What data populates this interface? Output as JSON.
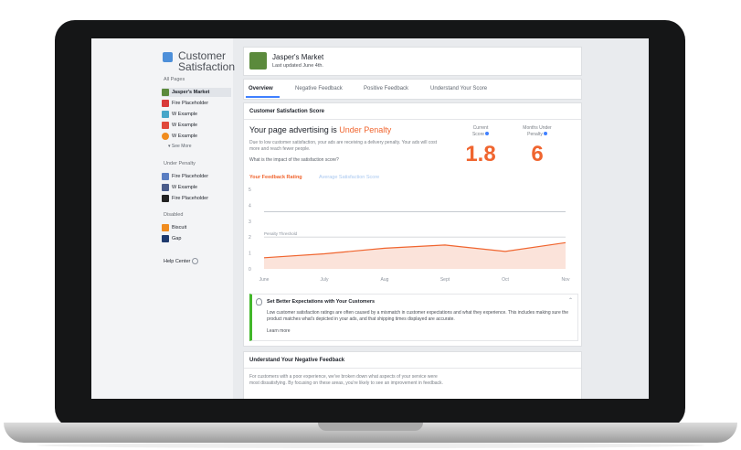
{
  "app": {
    "title": "Customer Satisfaction"
  },
  "sidebar": {
    "sections": {
      "all_pages": "All Pages",
      "under_penalty": "Under Penalty",
      "disabled": "Disabled"
    },
    "all_pages": [
      {
        "label": "Jasper's Market",
        "color": "#5b8a3c",
        "active": true
      },
      {
        "label": "Fire Placeholder",
        "color": "#d93a3a"
      },
      {
        "label": "W Example",
        "color": "#47a6c9"
      },
      {
        "label": "W Example",
        "color": "#e0483b"
      },
      {
        "label": "W Example",
        "color": "#f08c1f"
      }
    ],
    "see_more": "See More",
    "under_penalty": [
      {
        "label": "Fire Placeholder",
        "color": "#5a7ec2"
      },
      {
        "label": "W Example",
        "color": "#4a5c8a"
      },
      {
        "label": "Fire Placeholder",
        "color": "#222222"
      }
    ],
    "disabled": [
      {
        "label": "Biscuit",
        "color": "#f08c1f"
      },
      {
        "label": "Gap",
        "color": "#1f3a6e"
      }
    ],
    "help": "Help Center"
  },
  "header": {
    "page_name": "Jasper's Market",
    "updated": "Last updated June 4th."
  },
  "tabs": [
    {
      "label": "Overview",
      "active": true
    },
    {
      "label": "Negative Feedback"
    },
    {
      "label": "Positive Feedback"
    },
    {
      "label": "Understand Your Score"
    }
  ],
  "score_card": {
    "title": "Customer Satisfaction Score",
    "headline_prefix": "Your page advertising is ",
    "headline_status": "Under Penalty",
    "description": "Due to low customer satisfaction, your ads are receiving a delivery penalty. Your ads will cost more and reach fewer people.",
    "impact_link": "What is the impact of the satisfaction score?",
    "current_label": "Current Score",
    "current_value": "1.8",
    "months_label": "Months Under Penalty",
    "months_value": "6",
    "legend_rating": "Your Feedback Rating",
    "legend_average": "Average Satisfaction Score"
  },
  "chart_data": {
    "type": "area",
    "x": [
      "June",
      "July",
      "Aug",
      "Sept",
      "Oct",
      "Nov"
    ],
    "series": [
      {
        "name": "Your Feedback Rating",
        "values": [
          0.7,
          0.95,
          1.3,
          1.5,
          1.1,
          1.65
        ]
      },
      {
        "name": "Average Satisfaction Score",
        "values": [
          3.6,
          3.6,
          3.6,
          3.6,
          3.6,
          3.6
        ]
      }
    ],
    "yticks": [
      "0",
      "1",
      "2",
      "3",
      "4",
      "5"
    ],
    "ylim": [
      0,
      5
    ],
    "threshold": 2,
    "threshold_label": "Penalty Threshold",
    "colors": {
      "rating": "#f0652f",
      "average": "#a9c8f0"
    }
  },
  "tip": {
    "title": "Set Better Expectations with Your Customers",
    "body": "Low customer satisfaction ratings are often caused by a mismatch in customer expectations and what they experience. This includes making sure the product matches what's depicted in your ads, and that shipping times displayed are accurate.",
    "link": "Learn more"
  },
  "negative": {
    "title": "Understand Your Negative Feedback",
    "body": "For customers with a poor experience, we've broken down what aspects of your service were most dissatisfying. By focusing on these areas, you're likely to see an improvement in feedback."
  }
}
